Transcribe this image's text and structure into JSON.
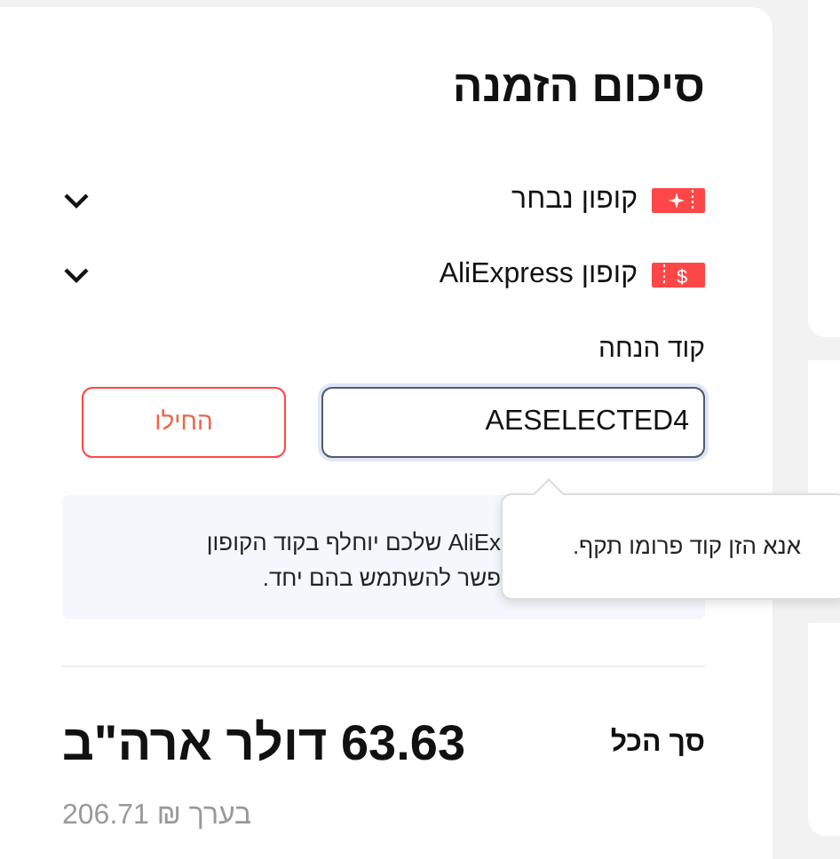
{
  "title": "סיכום הזמנה",
  "coupons": [
    {
      "label": "קופון נבחר",
      "kind": "sparkle",
      "expanded": false
    },
    {
      "label": "קופון AliExpress",
      "kind": "dollar",
      "glyph": "$",
      "expanded": false
    }
  ],
  "promo": {
    "label": "קוד הנחה",
    "value": "AESELECTED4",
    "button": "החילו"
  },
  "info_lines": [
    "AliEx שלכם יוחלף בקוד הקופון",
    "פשר להשתמש בהם יחד."
  ],
  "tooltip": "אנא הזן קוד פרומו תקף.",
  "total": {
    "label": "סך הכל",
    "amount": "63.63 דולר ארה\"ב",
    "approx": "בערך ₪ 206.71"
  }
}
